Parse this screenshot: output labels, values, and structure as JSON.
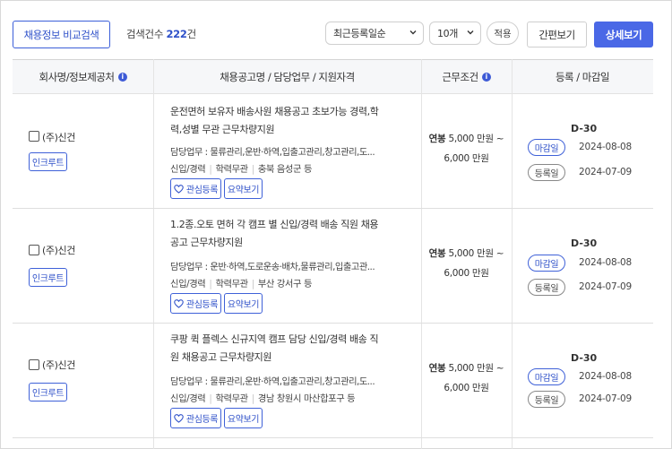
{
  "toolbar": {
    "compare_label": "채용정보 비교검색",
    "count_prefix": "검색건수",
    "count_value": "222",
    "count_suffix": "건",
    "sort_selected": "최근등록일순",
    "page_size_selected": "10개",
    "apply_label": "적용",
    "simple_view_label": "간편보기",
    "detail_view_label": "상세보기"
  },
  "table": {
    "headers": {
      "company": "회사명/정보제공처",
      "job": "채용공고명 / 담당업무 / 지원자격",
      "conditions": "근무조건",
      "dates": "등록 / 마감일"
    },
    "rows": [
      {
        "company": "(주)신건",
        "source": "인크루트",
        "title": "운전면허 보유자 배송사원 채용공고 초보가능 경력,학력,성별 무관 근무차량지원",
        "duty": "담당업무 : 물류관리,운반·하역,입출고관리,창고관리,도...",
        "career": "신입/경력",
        "education": "학력무관",
        "location": "충북 음성군 등",
        "fav_label": "관심등록",
        "summary_label": "요약보기",
        "salary_label": "연봉",
        "salary_range": "5,000 만원 ~",
        "salary_max": "6,000 만원",
        "dday": "D-30",
        "close_label": "마감일",
        "close_date": "2024-08-08",
        "reg_label": "등록일",
        "reg_date": "2024-07-09"
      },
      {
        "company": "(주)신건",
        "source": "인크루트",
        "title": "1.2종.오토 면허 각 캠프 별 신입/경력 배송 직원 채용 공고 근무차량지원",
        "duty": "담당업무 : 운반·하역,도로운송·배차,물류관리,입출고관...",
        "career": "신입/경력",
        "education": "학력무관",
        "location": "부산 강서구 등",
        "fav_label": "관심등록",
        "summary_label": "요약보기",
        "salary_label": "연봉",
        "salary_range": "5,000 만원 ~",
        "salary_max": "6,000 만원",
        "dday": "D-30",
        "close_label": "마감일",
        "close_date": "2024-08-08",
        "reg_label": "등록일",
        "reg_date": "2024-07-09"
      },
      {
        "company": "(주)신건",
        "source": "인크루트",
        "title": "쿠팡 퀵 플렉스 신규지역 캠프 담당 신입/경력 배송 직원 채용공고 근무차량지원",
        "duty": "담당업무 : 물류관리,운반·하역,입출고관리,창고관리,도...",
        "career": "신입/경력",
        "education": "학력무관",
        "location": "경남 창원시 마산합포구 등",
        "fav_label": "관심등록",
        "summary_label": "요약보기",
        "salary_label": "연봉",
        "salary_range": "5,000 만원 ~",
        "salary_max": "6,000 만원",
        "dday": "D-30",
        "close_label": "마감일",
        "close_date": "2024-08-08",
        "reg_label": "등록일",
        "reg_date": "2024-07-09"
      }
    ]
  },
  "icons": {
    "info": "info-icon",
    "heart": "heart-icon",
    "dropdown": "chevron-down-icon"
  },
  "colors": {
    "accent": "#4a68e6",
    "link": "#2f51c9"
  }
}
